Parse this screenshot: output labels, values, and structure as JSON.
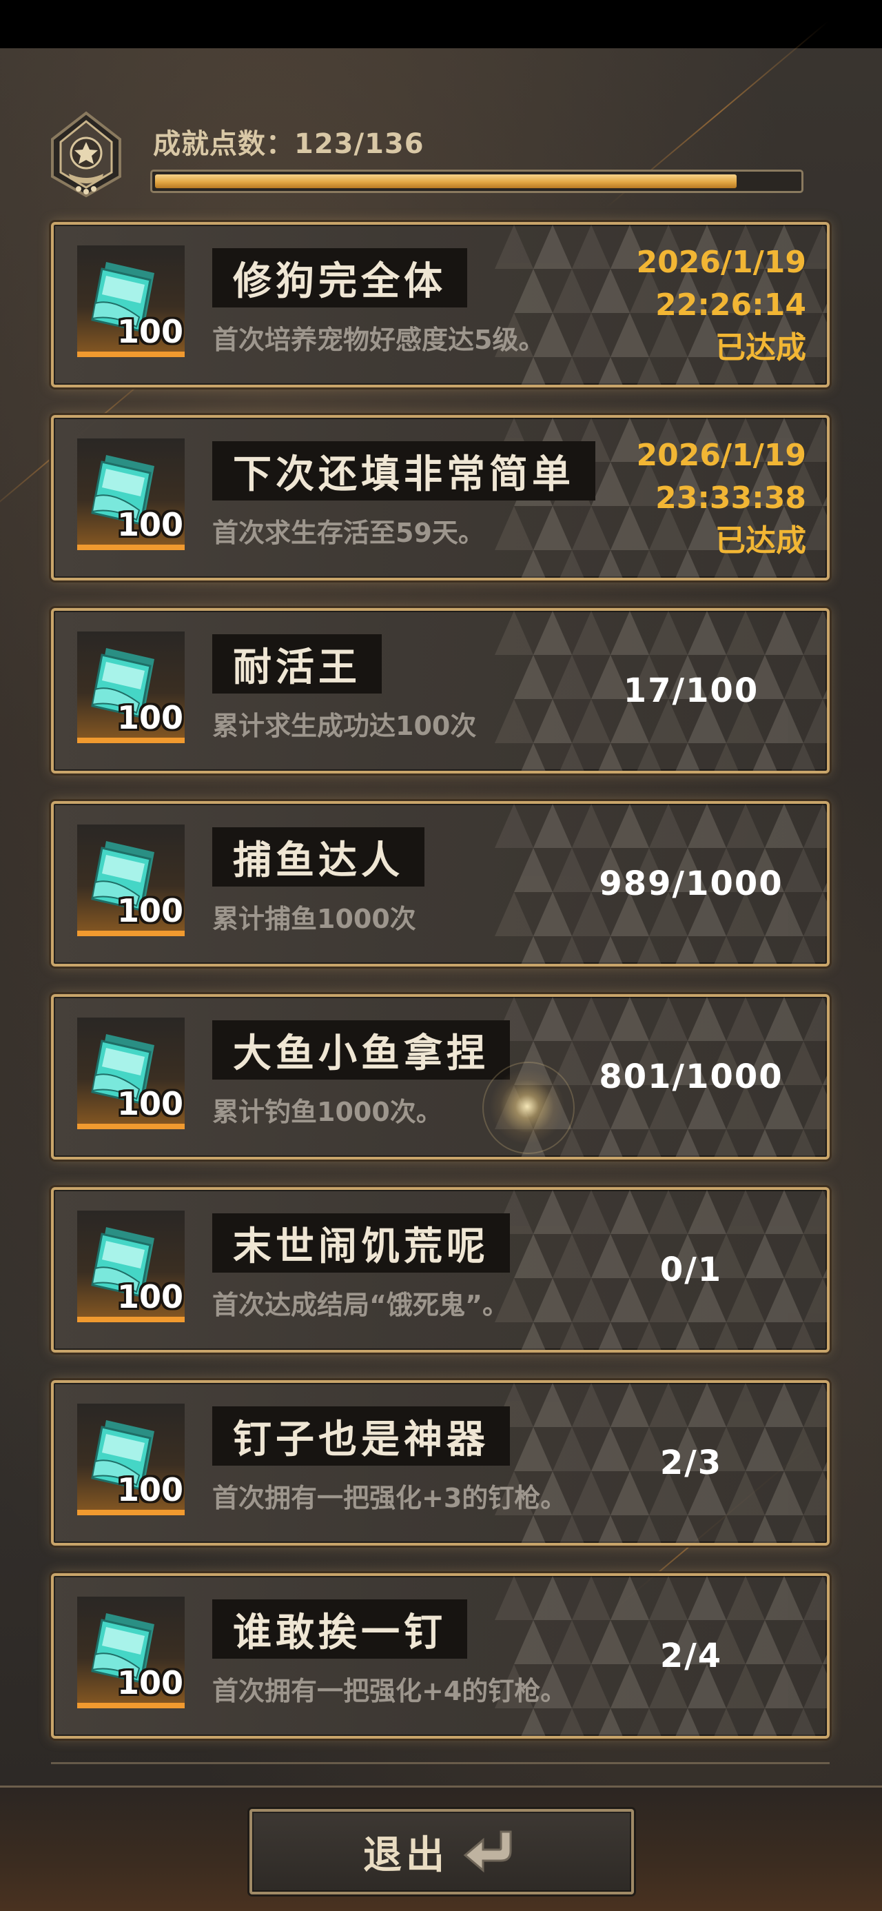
{
  "header": {
    "points_label": "成就点数：123/136",
    "points_current": 123,
    "points_total": 136,
    "progress_fraction": 0.904
  },
  "achievements": [
    {
      "title": "修狗完全体",
      "description": "首次培养宠物好感度达5级。",
      "reward": "100",
      "date": "2026/1/19",
      "time": "22:26:14",
      "status": "已达成"
    },
    {
      "title": "下次还填非常简单",
      "description": "首次求生存活至59天。",
      "reward": "100",
      "date": "2026/1/19",
      "time": "23:33:38",
      "status": "已达成"
    },
    {
      "title": "耐活王",
      "description": "累计求生成功达100次",
      "reward": "100",
      "progress": "17/100"
    },
    {
      "title": "捕鱼达人",
      "description": "累计捕鱼1000次",
      "reward": "100",
      "progress": "989/1000"
    },
    {
      "title": "大鱼小鱼拿捏",
      "description": "累计钓鱼1000次。",
      "reward": "100",
      "progress": "801/1000"
    },
    {
      "title": "末世闹饥荒呢",
      "description": "首次达成结局“饿死鬼”。",
      "reward": "100",
      "progress": "0/1"
    },
    {
      "title": "钉子也是神器",
      "description": "首次拥有一把强化+3的钉枪。",
      "reward": "100",
      "progress": "2/3"
    },
    {
      "title": "谁敢挨一钉",
      "description": "首次拥有一把强化+4的钉枪。",
      "reward": "100",
      "progress": "2/4"
    }
  ],
  "footer": {
    "exit_label": "退出",
    "exit_icon": "return-arrow-icon"
  },
  "colors": {
    "accent_gold": "#f2b634",
    "border_gold": "#c9a56a",
    "progress_fill": "#e2a744"
  }
}
